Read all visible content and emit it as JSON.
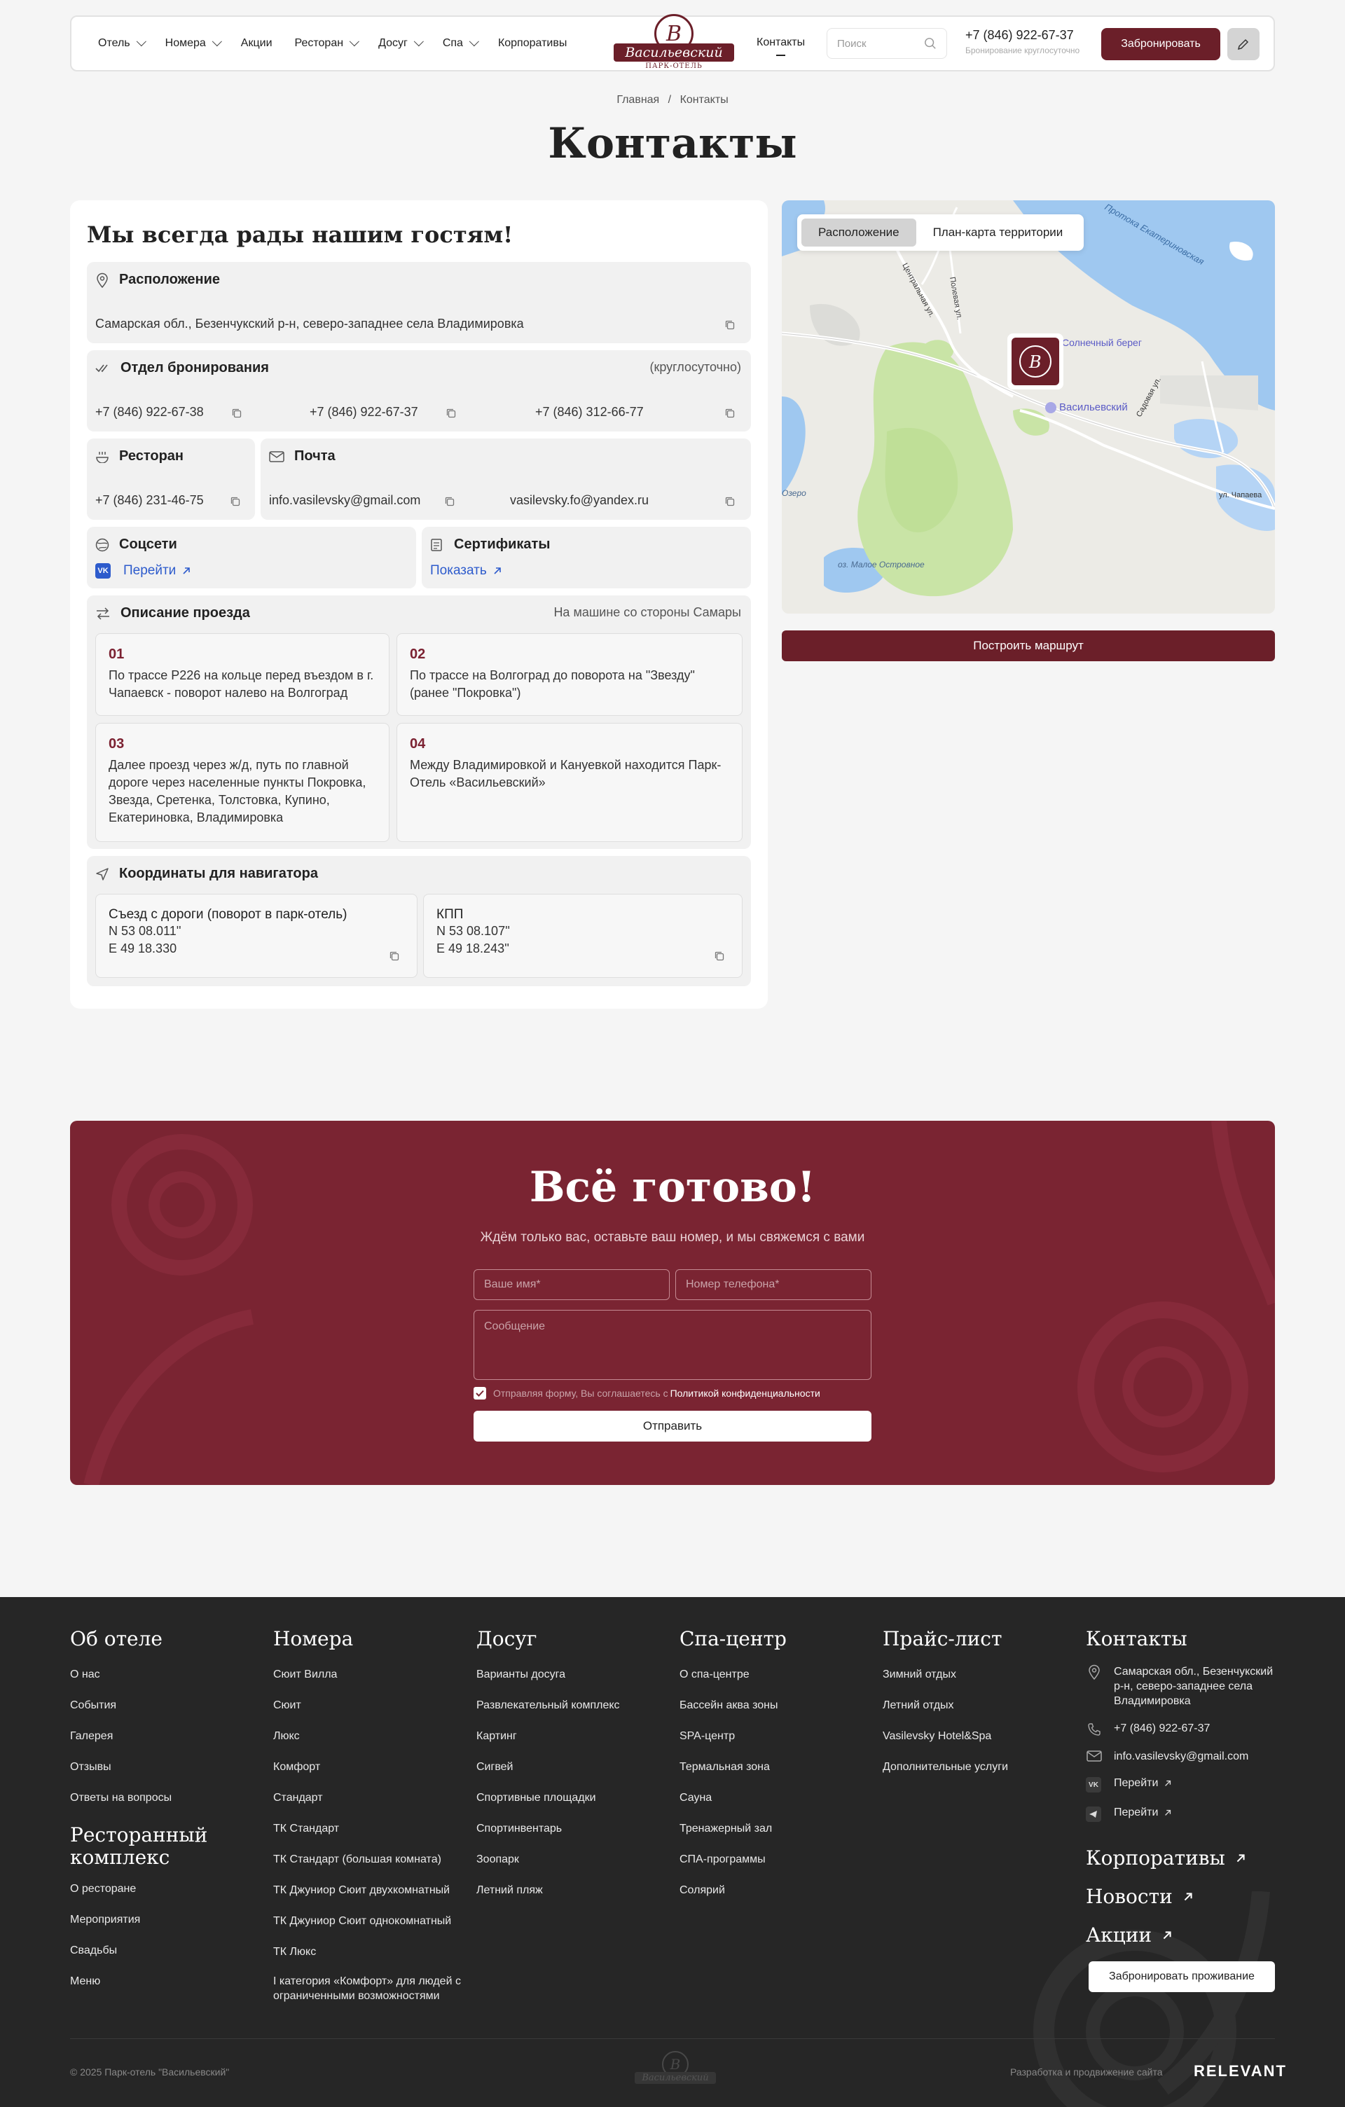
{
  "header": {
    "nav": [
      {
        "label": "Отель",
        "dropdown": true
      },
      {
        "label": "Номера",
        "dropdown": true
      },
      {
        "label": "Акции",
        "dropdown": false
      },
      {
        "label": "Ресторан",
        "dropdown": true
      },
      {
        "label": "Досуг",
        "dropdown": true
      },
      {
        "label": "Спа",
        "dropdown": true
      },
      {
        "label": "Корпоративы",
        "dropdown": false
      }
    ],
    "logo": {
      "letter": "В",
      "name": "Васильевский",
      "sub": "ПАРК-ОТЕЛЬ"
    },
    "contacts_link": "Контакты",
    "search_placeholder": "Поиск",
    "phone": "+7 (846) 922-67-37",
    "phone_note": "Бронирование круглосуточно",
    "book_label": "Забронировать"
  },
  "breadcrumb": {
    "home": "Главная",
    "sep": "/",
    "current": "Контакты"
  },
  "page_title": "Контакты",
  "contacts": {
    "title": "Мы всегда рады нашим гостям!",
    "location": {
      "label": "Расположение",
      "address": "Самарская обл., Безенчукский р-н, северо-западнее села Владимировка"
    },
    "booking": {
      "label": "Отдел бронирования",
      "note": "(круглосуточно)",
      "phones": [
        "+7 (846) 922-67-38",
        "+7 (846) 922-67-37",
        "+7 (846) 312-66-77"
      ]
    },
    "restaurant": {
      "label": "Ресторан",
      "phone": "+7 (846) 231-46-75"
    },
    "mail": {
      "label": "Почта",
      "emails": [
        "info.vasilevsky@gmail.com",
        "vasilevsky.fo@yandex.ru"
      ]
    },
    "social": {
      "label": "Соцсети",
      "vk_badge": "VK",
      "link": "Перейти"
    },
    "certs": {
      "label": "Сертификаты",
      "link": "Показать"
    },
    "route": {
      "label": "Описание проезда",
      "note": "На машине со стороны Самары",
      "steps": [
        {
          "num": "01",
          "text": "По трассе Р226 на кольце перед въездом в г. Чапаевск - поворот налево на Волгоград"
        },
        {
          "num": "02",
          "text": "По трассе на Волгоград до поворота на \"Звезду\" (ранее \"Покровка\")"
        },
        {
          "num": "03",
          "text": "Далее проезд через ж/д, путь по главной дороге через населенные пункты Покровка, Звезда, Сретенка, Толстовка, Купино, Екатериновка, Владимировка"
        },
        {
          "num": "04",
          "text": "Между Владимировкой и Кануевкой находится Парк-Отель «Васильевский»"
        }
      ]
    },
    "coords": {
      "label": "Координаты для навигатора",
      "items": [
        {
          "title": "Съезд с дороги (поворот в парк-отель)",
          "n": "N 53 08.011''",
          "e": "E 49 18.330"
        },
        {
          "title": "КПП",
          "n": "N 53 08.107''",
          "e": "E 49 18.243''"
        }
      ]
    }
  },
  "map": {
    "tabs": [
      "Расположение",
      "План-карта территории"
    ],
    "active_tab": 0,
    "labels": {
      "bereg": "Солнечный берег",
      "vasil": "Васильевский",
      "chapaeva": "ул. Чапаева",
      "lake": "оз. Малое Островное",
      "sadovaya": "Садовая ул.",
      "central": "Центральная ул.",
      "ozero": "Озеро",
      "ekaterinovskaya": "Протока Екатериновская",
      "poleva": "Полевая ул."
    },
    "route_button": "Построить маршрут"
  },
  "cta": {
    "title": "Всё готово!",
    "subtitle": "Ждём только вас, оставьте ваш номер, и мы свяжемся с вами",
    "name_placeholder": "Ваше имя*",
    "phone_placeholder": "Номер телефона*",
    "message_placeholder": "Сообщение",
    "consent_text": "Отправляя форму, Вы соглашаетесь с",
    "consent_link": "Политикой конфиденциальности",
    "submit": "Отправить"
  },
  "footer": {
    "about": {
      "title": "Об отеле",
      "links": [
        "О нас",
        "События",
        "Галерея",
        "Отзывы",
        "Ответы на вопросы"
      ]
    },
    "rest": {
      "title": "Ресторанный комплекс",
      "links": [
        "О ресторане",
        "Мероприятия",
        "Свадьбы",
        "Меню"
      ]
    },
    "rooms": {
      "title": "Номера",
      "links": [
        "Сюит Вилла",
        "Сюит",
        "Люкс",
        "Комфорт",
        "Стандарт",
        "ТК Стандарт",
        "ТК Стандарт (большая комната)",
        "ТК Джуниор Сюит двухкомнатный",
        "ТК Джуниор Сюит однокомнатный",
        "ТК Люкс",
        "I категория «Комфорт» для людей с ограниченными возможностями"
      ]
    },
    "leisure": {
      "title": "Досуг",
      "links": [
        "Варианты досуга",
        "Развлекательный комплекс",
        "Картинг",
        "Сигвей",
        "Спортивные площадки",
        "Спортинвентарь",
        "Зоопарк",
        "Летний пляж"
      ]
    },
    "spa": {
      "title": "Спа-центр",
      "links": [
        "О спа-центре",
        "Бассейн аква зоны",
        "SPA-центр",
        "Термальная зона",
        "Сауна",
        "Тренажерный зал",
        "СПА-программы",
        "Солярий"
      ]
    },
    "price": {
      "title": "Прайс-лист",
      "links": [
        "Зимний отдых",
        "Летний отдых",
        "Vasilevsky Hotel&Spa",
        "Дополнительные услуги"
      ]
    },
    "contacts": {
      "title": "Контакты",
      "address": "Самарская обл., Безенчукский р-н, северо-западнее села Владимировка",
      "phone": "+7 (846) 922-67-37",
      "email": "info.vasilevsky@gmail.com",
      "vk": "Перейти",
      "tg": "Перейти"
    },
    "big_links": [
      "Корпоративы",
      "Новости",
      "Акции"
    ],
    "book": "Забронировать проживание",
    "copyright": "© 2025 Парк-отель \"Васильевский\"",
    "dev": "Разработка и продвижение сайта",
    "dev_brand": "RELEVANT"
  }
}
